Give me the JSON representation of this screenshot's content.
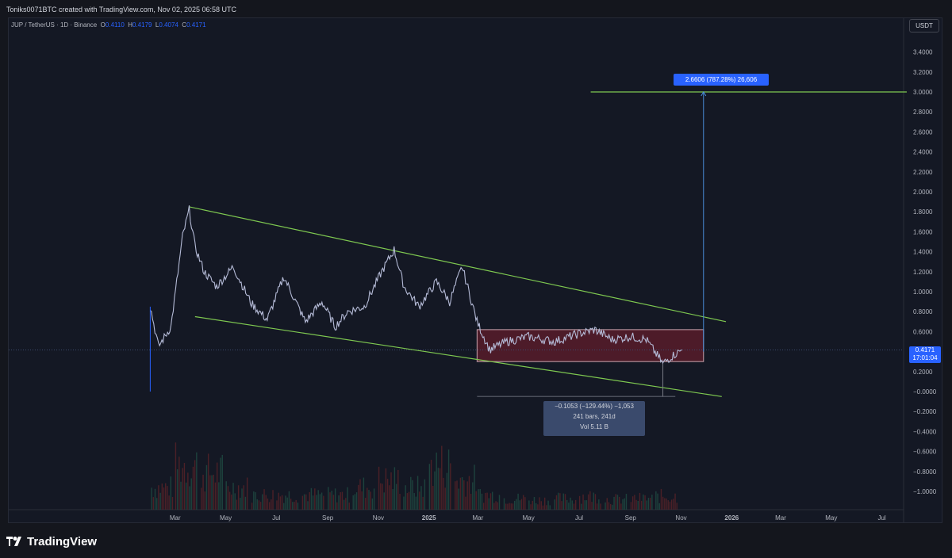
{
  "header": {
    "attribution": "Toniks0071BTC created with TradingView.com, Nov 02, 2025 06:58 UTC"
  },
  "symbol_line": {
    "symbol": "JUP / TetherUS · 1D · Binance",
    "o_label": "O",
    "o_value": "0.4110",
    "h_label": "H",
    "h_value": "0.4179",
    "l_label": "L",
    "l_value": "0.4074",
    "c_label": "C",
    "c_value": "0.4171"
  },
  "currency_button": "USDT",
  "price_tag": {
    "price": "0.4171",
    "countdown": "17:01:04"
  },
  "projection_label": "2.6606 (787.28%) 26,606",
  "measure_box": {
    "line1": "−0.1053 (−129.44%) −1,053",
    "line2": "241 bars, 241d",
    "line3": "Vol 5.11 B"
  },
  "brand": "TradingView",
  "colors": {
    "background": "#141824",
    "candles": "#b4bad6",
    "trendline": "#7ec850",
    "range_box": "#7c1f2e",
    "price_tag": "#2962ff",
    "volume_up": "#1f4d44",
    "volume_down": "#5a2328"
  },
  "chart_data": {
    "type": "line",
    "y_axis_labels": [
      "3.4000",
      "3.2000",
      "3.0000",
      "2.8000",
      "2.6000",
      "2.4000",
      "2.2000",
      "2.0000",
      "1.8000",
      "1.6000",
      "1.4000",
      "1.2000",
      "1.0000",
      "0.8000",
      "0.6000",
      "0.4000",
      "0.2000",
      "−0.0000",
      "−0.2000",
      "−0.4000",
      "−0.6000",
      "−0.8000",
      "−1.0000"
    ],
    "x_axis_labels": [
      "Mar",
      "May",
      "Jul",
      "Sep",
      "Nov",
      "2025",
      "Mar",
      "May",
      "Jul",
      "Sep",
      "Nov",
      "2026",
      "Mar",
      "May",
      "Jul"
    ],
    "ylim": [
      -1.1,
      3.55
    ],
    "series": [
      {
        "x": [
          "2024-01-31",
          "2024-02-10",
          "2024-02-25",
          "2024-03-10",
          "2024-03-18",
          "2024-03-25",
          "2024-04-05",
          "2024-04-20",
          "2024-05-10",
          "2024-06-01",
          "2024-06-20",
          "2024-07-10",
          "2024-08-05",
          "2024-08-25",
          "2024-09-10",
          "2024-09-25",
          "2024-10-15",
          "2024-11-05",
          "2024-11-20",
          "2024-12-02",
          "2024-12-20",
          "2025-01-10",
          "2025-01-26",
          "2025-02-10",
          "2025-02-28",
          "2025-03-15",
          "2025-04-05",
          "2025-05-01",
          "2025-06-01",
          "2025-07-01",
          "2025-07-20",
          "2025-08-10",
          "2025-09-01",
          "2025-09-20",
          "2025-10-10",
          "2025-10-20",
          "2025-11-02"
        ],
        "values": [
          0.85,
          0.45,
          0.65,
          1.55,
          1.82,
          1.45,
          1.2,
          1.05,
          1.25,
          0.88,
          0.72,
          1.15,
          0.7,
          0.9,
          0.65,
          0.8,
          0.85,
          1.2,
          1.42,
          1.05,
          0.85,
          1.1,
          0.9,
          1.25,
          0.7,
          0.42,
          0.5,
          0.55,
          0.5,
          0.58,
          0.62,
          0.52,
          0.55,
          0.52,
          0.28,
          0.35,
          0.4171
        ]
      }
    ],
    "volume": {
      "x": [
        "2024-02",
        "2024-03",
        "2024-04",
        "2024-05",
        "2024-06",
        "2024-07",
        "2024-08",
        "2024-09",
        "2024-10",
        "2024-11",
        "2024-12",
        "2025-01",
        "2025-02",
        "2025-03",
        "2025-04",
        "2025-05",
        "2025-06",
        "2025-07",
        "2025-08",
        "2025-09",
        "2025-10"
      ],
      "values": [
        3,
        6,
        5,
        3,
        2,
        2,
        2,
        2,
        3,
        4,
        3,
        6,
        4,
        2,
        1.5,
        1.3,
        1.5,
        1.8,
        1.4,
        1.5,
        1.8
      ]
    },
    "drawings": {
      "upper_trendline": [
        [
          "2024-03-18",
          1.85
        ],
        [
          "2025-12-25",
          0.7
        ]
      ],
      "lower_trendline": [
        [
          "2024-03-25",
          0.75
        ],
        [
          "2025-12-20",
          -0.05
        ]
      ],
      "range_box": [
        [
          "2025-02-28",
          0.3
        ],
        [
          "2025-11-28",
          0.62
        ]
      ],
      "target_line": {
        "from": "2025-07-15",
        "to": "2026-07-31",
        "y": 3.0
      },
      "current_price": 0.4171
    }
  }
}
